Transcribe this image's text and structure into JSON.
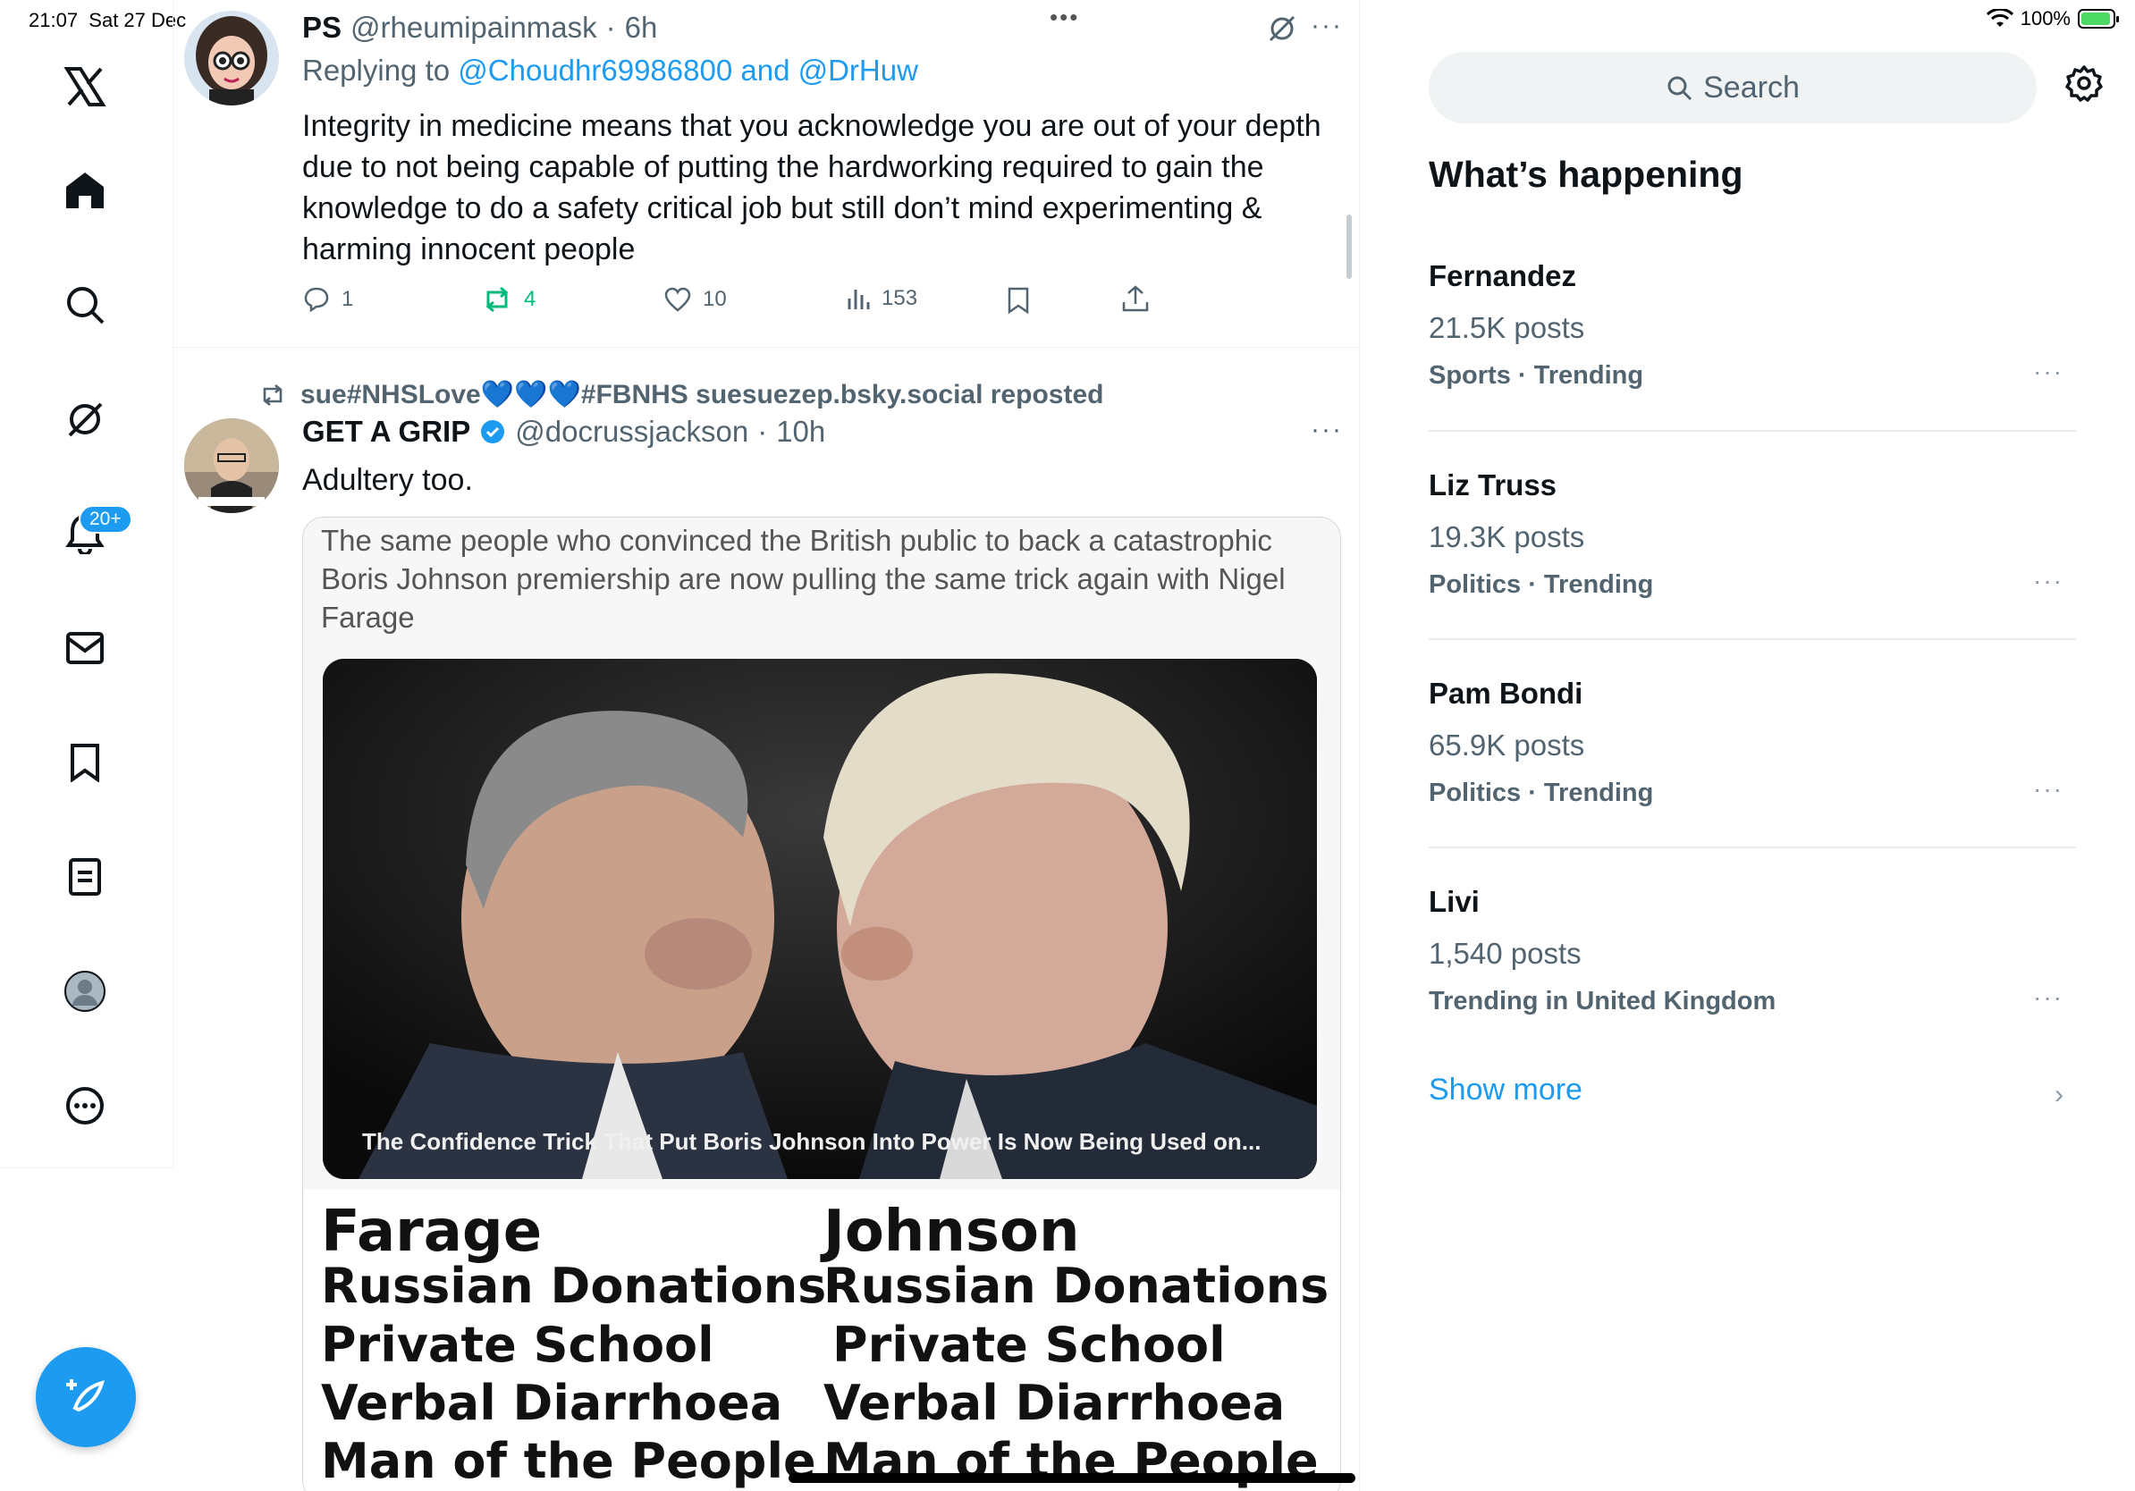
{
  "status": {
    "time": "21:07",
    "date": "Sat 27 Dec",
    "battery": "100%",
    "wifi_icon": "wifi-icon",
    "battery_icon": "battery-charging-icon"
  },
  "nav": {
    "items": [
      "x-logo-icon",
      "home-icon",
      "search-icon",
      "grok-icon",
      "notifications-icon",
      "messages-icon",
      "bookmarks-icon",
      "lists-icon",
      "profile-icon",
      "more-icon"
    ],
    "notification_badge": "20+",
    "compose_icon": "compose-icon"
  },
  "tweet1": {
    "name": "PS",
    "handle": "@rheumipainmask",
    "time": "6h",
    "replying_prefix": "Replying to",
    "replying_users": "@Choudhr69986800 and @DrHuw",
    "text": "Integrity in medicine means that you acknowledge you are out of your depth due to not being capable of putting the hardworking required to gain the knowledge to do a safety critical job but still don’t mind experimenting & harming innocent people",
    "replies": "1",
    "reposts": "4",
    "likes": "10",
    "views": "153",
    "top_dots": "•••",
    "menu_dots": "···"
  },
  "tweet2": {
    "repost_label": "sue#NHSLove💙💙💙#FBNHS suesuezep.bsky.social reposted",
    "name": "GET A GRIP",
    "handle": "@docrussjackson",
    "time": "10h",
    "text": "Adultery too.",
    "menu_dots": "···",
    "media_caption": "The same people who convinced the British public to back a catastrophic Boris Johnson premiership are now pulling the same trick again with Nigel Farage",
    "photo_caption": "The Confidence Trick That Put Boris Johnson Into Power Is Now Being Used on...",
    "list_left": [
      "Farage",
      "Russian Donations",
      "Private School",
      "Verbal Diarrhoea",
      "Man of the People"
    ],
    "list_right": [
      "Johnson",
      "Russian Donations",
      "Private School",
      "Verbal Diarrhoea",
      "Man of the People"
    ]
  },
  "sidebar": {
    "search_placeholder": "Search",
    "title": "What’s happening",
    "trends": [
      {
        "name": "Fernandez",
        "posts": "21.5K posts",
        "category": "Sports · Trending"
      },
      {
        "name": "Liz Truss",
        "posts": "19.3K posts",
        "category": "Politics · Trending"
      },
      {
        "name": "Pam Bondi",
        "posts": "65.9K posts",
        "category": "Politics · Trending"
      },
      {
        "name": "Livi",
        "posts": "1,540 posts",
        "category": "Trending in United Kingdom"
      }
    ],
    "trend_dots": "···",
    "show_more": "Show more",
    "chevron": "›"
  }
}
